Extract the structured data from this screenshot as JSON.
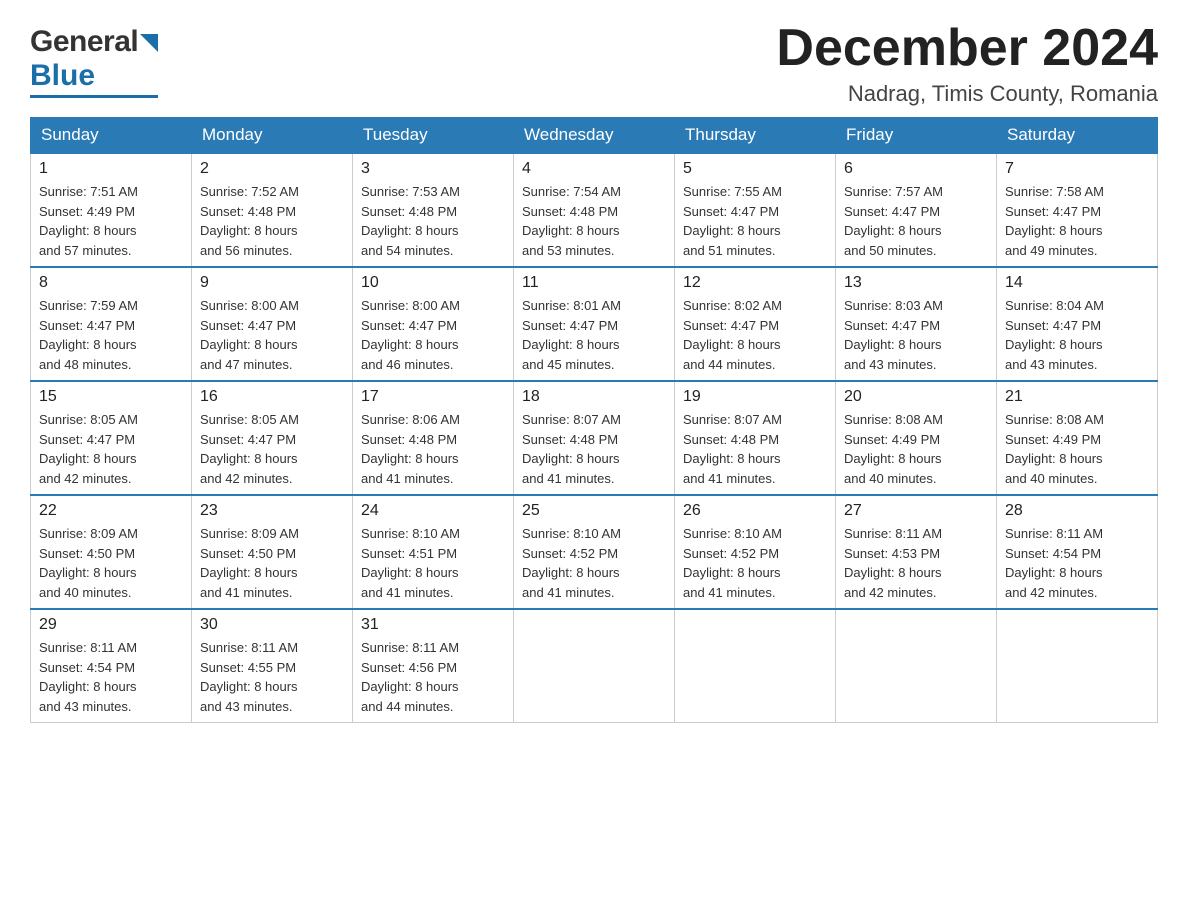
{
  "header": {
    "month_year": "December 2024",
    "location": "Nadrag, Timis County, Romania",
    "logo_general": "General",
    "logo_blue": "Blue"
  },
  "weekdays": [
    "Sunday",
    "Monday",
    "Tuesday",
    "Wednesday",
    "Thursday",
    "Friday",
    "Saturday"
  ],
  "weeks": [
    [
      {
        "day": "1",
        "sunrise": "Sunrise: 7:51 AM",
        "sunset": "Sunset: 4:49 PM",
        "daylight": "Daylight: 8 hours",
        "daylight2": "and 57 minutes."
      },
      {
        "day": "2",
        "sunrise": "Sunrise: 7:52 AM",
        "sunset": "Sunset: 4:48 PM",
        "daylight": "Daylight: 8 hours",
        "daylight2": "and 56 minutes."
      },
      {
        "day": "3",
        "sunrise": "Sunrise: 7:53 AM",
        "sunset": "Sunset: 4:48 PM",
        "daylight": "Daylight: 8 hours",
        "daylight2": "and 54 minutes."
      },
      {
        "day": "4",
        "sunrise": "Sunrise: 7:54 AM",
        "sunset": "Sunset: 4:48 PM",
        "daylight": "Daylight: 8 hours",
        "daylight2": "and 53 minutes."
      },
      {
        "day": "5",
        "sunrise": "Sunrise: 7:55 AM",
        "sunset": "Sunset: 4:47 PM",
        "daylight": "Daylight: 8 hours",
        "daylight2": "and 51 minutes."
      },
      {
        "day": "6",
        "sunrise": "Sunrise: 7:57 AM",
        "sunset": "Sunset: 4:47 PM",
        "daylight": "Daylight: 8 hours",
        "daylight2": "and 50 minutes."
      },
      {
        "day": "7",
        "sunrise": "Sunrise: 7:58 AM",
        "sunset": "Sunset: 4:47 PM",
        "daylight": "Daylight: 8 hours",
        "daylight2": "and 49 minutes."
      }
    ],
    [
      {
        "day": "8",
        "sunrise": "Sunrise: 7:59 AM",
        "sunset": "Sunset: 4:47 PM",
        "daylight": "Daylight: 8 hours",
        "daylight2": "and 48 minutes."
      },
      {
        "day": "9",
        "sunrise": "Sunrise: 8:00 AM",
        "sunset": "Sunset: 4:47 PM",
        "daylight": "Daylight: 8 hours",
        "daylight2": "and 47 minutes."
      },
      {
        "day": "10",
        "sunrise": "Sunrise: 8:00 AM",
        "sunset": "Sunset: 4:47 PM",
        "daylight": "Daylight: 8 hours",
        "daylight2": "and 46 minutes."
      },
      {
        "day": "11",
        "sunrise": "Sunrise: 8:01 AM",
        "sunset": "Sunset: 4:47 PM",
        "daylight": "Daylight: 8 hours",
        "daylight2": "and 45 minutes."
      },
      {
        "day": "12",
        "sunrise": "Sunrise: 8:02 AM",
        "sunset": "Sunset: 4:47 PM",
        "daylight": "Daylight: 8 hours",
        "daylight2": "and 44 minutes."
      },
      {
        "day": "13",
        "sunrise": "Sunrise: 8:03 AM",
        "sunset": "Sunset: 4:47 PM",
        "daylight": "Daylight: 8 hours",
        "daylight2": "and 43 minutes."
      },
      {
        "day": "14",
        "sunrise": "Sunrise: 8:04 AM",
        "sunset": "Sunset: 4:47 PM",
        "daylight": "Daylight: 8 hours",
        "daylight2": "and 43 minutes."
      }
    ],
    [
      {
        "day": "15",
        "sunrise": "Sunrise: 8:05 AM",
        "sunset": "Sunset: 4:47 PM",
        "daylight": "Daylight: 8 hours",
        "daylight2": "and 42 minutes."
      },
      {
        "day": "16",
        "sunrise": "Sunrise: 8:05 AM",
        "sunset": "Sunset: 4:47 PM",
        "daylight": "Daylight: 8 hours",
        "daylight2": "and 42 minutes."
      },
      {
        "day": "17",
        "sunrise": "Sunrise: 8:06 AM",
        "sunset": "Sunset: 4:48 PM",
        "daylight": "Daylight: 8 hours",
        "daylight2": "and 41 minutes."
      },
      {
        "day": "18",
        "sunrise": "Sunrise: 8:07 AM",
        "sunset": "Sunset: 4:48 PM",
        "daylight": "Daylight: 8 hours",
        "daylight2": "and 41 minutes."
      },
      {
        "day": "19",
        "sunrise": "Sunrise: 8:07 AM",
        "sunset": "Sunset: 4:48 PM",
        "daylight": "Daylight: 8 hours",
        "daylight2": "and 41 minutes."
      },
      {
        "day": "20",
        "sunrise": "Sunrise: 8:08 AM",
        "sunset": "Sunset: 4:49 PM",
        "daylight": "Daylight: 8 hours",
        "daylight2": "and 40 minutes."
      },
      {
        "day": "21",
        "sunrise": "Sunrise: 8:08 AM",
        "sunset": "Sunset: 4:49 PM",
        "daylight": "Daylight: 8 hours",
        "daylight2": "and 40 minutes."
      }
    ],
    [
      {
        "day": "22",
        "sunrise": "Sunrise: 8:09 AM",
        "sunset": "Sunset: 4:50 PM",
        "daylight": "Daylight: 8 hours",
        "daylight2": "and 40 minutes."
      },
      {
        "day": "23",
        "sunrise": "Sunrise: 8:09 AM",
        "sunset": "Sunset: 4:50 PM",
        "daylight": "Daylight: 8 hours",
        "daylight2": "and 41 minutes."
      },
      {
        "day": "24",
        "sunrise": "Sunrise: 8:10 AM",
        "sunset": "Sunset: 4:51 PM",
        "daylight": "Daylight: 8 hours",
        "daylight2": "and 41 minutes."
      },
      {
        "day": "25",
        "sunrise": "Sunrise: 8:10 AM",
        "sunset": "Sunset: 4:52 PM",
        "daylight": "Daylight: 8 hours",
        "daylight2": "and 41 minutes."
      },
      {
        "day": "26",
        "sunrise": "Sunrise: 8:10 AM",
        "sunset": "Sunset: 4:52 PM",
        "daylight": "Daylight: 8 hours",
        "daylight2": "and 41 minutes."
      },
      {
        "day": "27",
        "sunrise": "Sunrise: 8:11 AM",
        "sunset": "Sunset: 4:53 PM",
        "daylight": "Daylight: 8 hours",
        "daylight2": "and 42 minutes."
      },
      {
        "day": "28",
        "sunrise": "Sunrise: 8:11 AM",
        "sunset": "Sunset: 4:54 PM",
        "daylight": "Daylight: 8 hours",
        "daylight2": "and 42 minutes."
      }
    ],
    [
      {
        "day": "29",
        "sunrise": "Sunrise: 8:11 AM",
        "sunset": "Sunset: 4:54 PM",
        "daylight": "Daylight: 8 hours",
        "daylight2": "and 43 minutes."
      },
      {
        "day": "30",
        "sunrise": "Sunrise: 8:11 AM",
        "sunset": "Sunset: 4:55 PM",
        "daylight": "Daylight: 8 hours",
        "daylight2": "and 43 minutes."
      },
      {
        "day": "31",
        "sunrise": "Sunrise: 8:11 AM",
        "sunset": "Sunset: 4:56 PM",
        "daylight": "Daylight: 8 hours",
        "daylight2": "and 44 minutes."
      },
      null,
      null,
      null,
      null
    ]
  ]
}
